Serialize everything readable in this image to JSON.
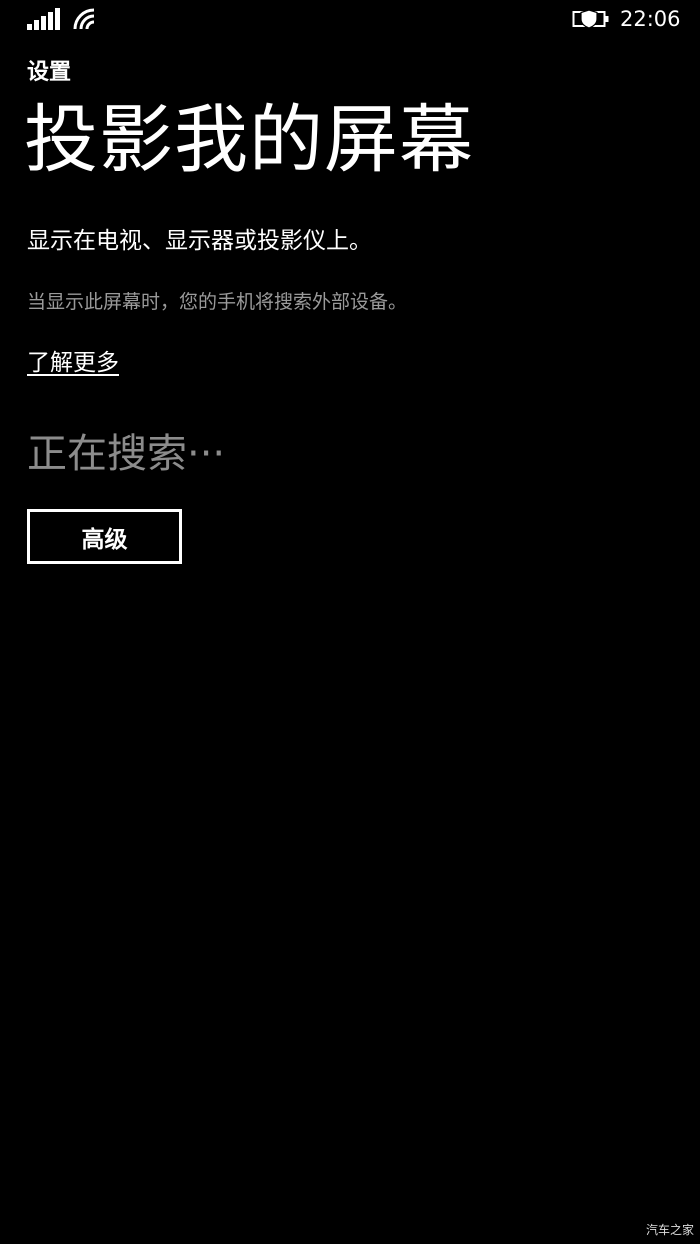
{
  "status_bar": {
    "signal_icon": "signal-bars-icon",
    "wifi_icon": "wifi-icon",
    "battery_icon": "battery-saver-icon",
    "time": "22:06"
  },
  "header": {
    "app_title": "设置",
    "page_title": "投影我的屏幕"
  },
  "content": {
    "description": "显示在电视、显示器或投影仪上。",
    "subtext": "当显示此屏幕时，您的手机将搜索外部设备。",
    "learn_more_label": "了解更多",
    "status_text": "正在搜索···",
    "advanced_button_label": "高级"
  },
  "watermark": "汽车之家",
  "colors": {
    "background": "#000000",
    "foreground": "#ffffff",
    "secondary_text": "#9a9a9a",
    "status_text": "#8c8c8c"
  }
}
